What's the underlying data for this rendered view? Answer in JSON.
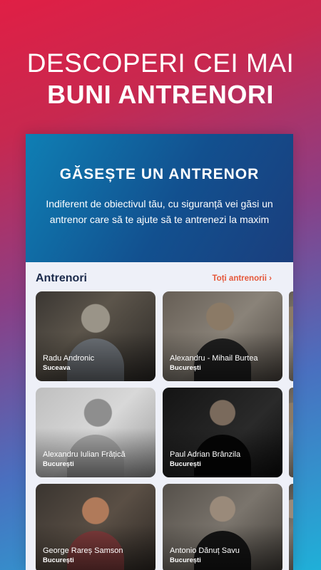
{
  "promo": {
    "line1": "DESCOPERI CEI MAI",
    "line2": "BUNI ANTRENORI"
  },
  "hero": {
    "title": "GĂSEȘTE UN ANTRENOR",
    "subtitle": "Indiferent de obiectivul tău, cu siguranță vei găsi un antrenor care să te ajute să te antrenezi la maxim"
  },
  "section": {
    "title": "Antrenori",
    "link": "Toți antrenorii ›"
  },
  "trainers": [
    {
      "name": "Radu Andronic",
      "city": "Suceava"
    },
    {
      "name": "Alexandru - Mihail Burtea",
      "city": "București"
    },
    {
      "name": "Alexandru Iulian Frățică",
      "city": "București"
    },
    {
      "name": "Paul Adrian Brânzila",
      "city": "București"
    },
    {
      "name": "George Rareș Samson",
      "city": "București"
    },
    {
      "name": "Antonio Dănuț Savu",
      "city": "București"
    }
  ]
}
